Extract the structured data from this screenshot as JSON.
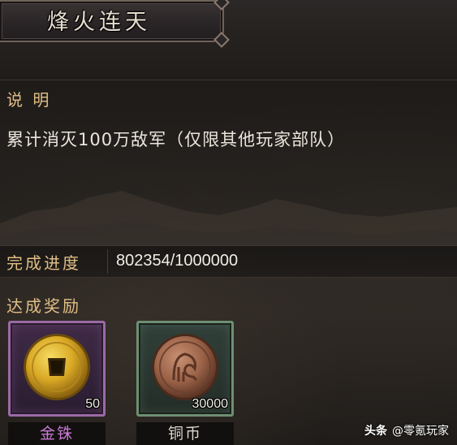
{
  "title": "烽火连天",
  "description_section": {
    "label": "说 明",
    "text": "累计消灭100万敌军（仅限其他玩家部队）"
  },
  "progress": {
    "label": "完成进度",
    "value_text": "802354/1000000",
    "current": 802354,
    "target": 1000000
  },
  "rewards_section": {
    "label": "达成奖励",
    "items": [
      {
        "name": "金铢",
        "count": "50",
        "icon": "gold-coin-icon",
        "rarity_color": "#9b6aa6"
      },
      {
        "name": "铜币",
        "count": "30000",
        "icon": "copper-coin-icon",
        "rarity_color": "#6e8f72"
      }
    ]
  },
  "watermark": {
    "brand": "头条",
    "handle": "@零氪玩家"
  },
  "colors": {
    "label_gold": "#e0be86",
    "text_light": "#ebe6dc",
    "purple_rarity": "#9b6aa6",
    "green_rarity": "#6e8f72"
  }
}
